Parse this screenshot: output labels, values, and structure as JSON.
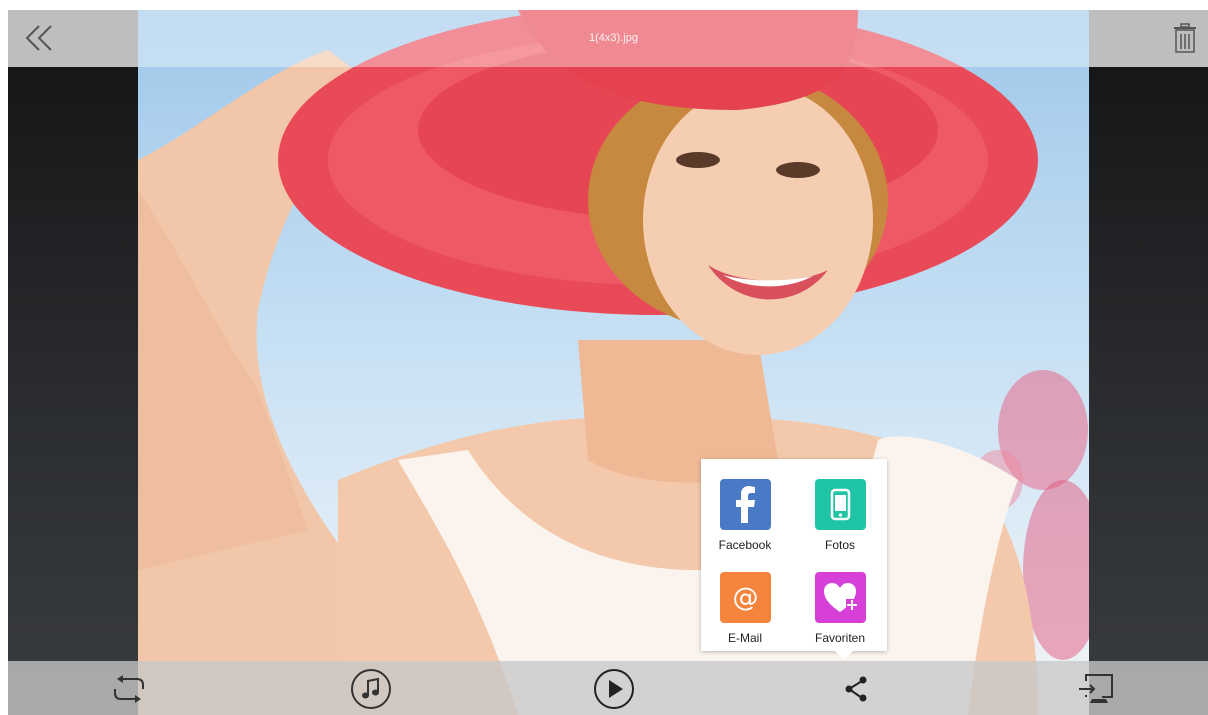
{
  "viewer": {
    "title": "1(4x3).jpg",
    "back_icon": "double-chevron-left-icon",
    "delete_icon": "trash-icon"
  },
  "toolbar": {
    "buttons": [
      {
        "icon": "repeat-icon",
        "name": "repeat-button"
      },
      {
        "icon": "music-note-icon",
        "name": "music-button"
      },
      {
        "icon": "play-icon",
        "name": "play-button"
      },
      {
        "icon": "share-icon",
        "name": "share-button"
      },
      {
        "icon": "cast-display-icon",
        "name": "cast-button"
      }
    ]
  },
  "share_menu": {
    "items": [
      {
        "label": "Facebook",
        "icon": "facebook-icon",
        "color": "#4a79c6"
      },
      {
        "label": "Fotos",
        "icon": "phone-icon",
        "color": "#1fc4a4"
      },
      {
        "label": "E-Mail",
        "icon": "at-sign-icon",
        "color": "#f5843d"
      },
      {
        "label": "Favoriten",
        "icon": "heart-plus-icon",
        "color": "#d640d6"
      }
    ]
  },
  "colors": {
    "bar_gray": "#cdcdcd",
    "icon_dark": "#333333"
  }
}
